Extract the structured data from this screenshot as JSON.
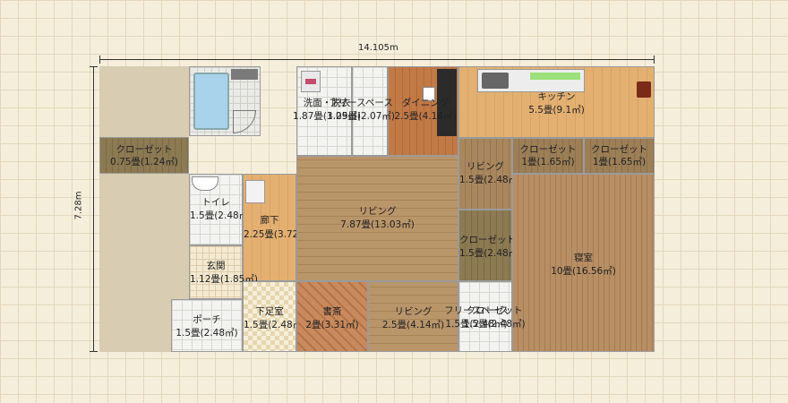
{
  "dimensions": {
    "width_label": "14.105m",
    "height_label": "7.28m"
  },
  "rooms": {
    "closet_left": {
      "name": "クローゼット",
      "size": "0.75畳(1.24㎡)"
    },
    "washroom": {
      "name": "洗面・脱衣",
      "size": "1.87畳(3.09㎡)"
    },
    "free_space": {
      "name": "フリースペース",
      "size": "1.25畳(2.07㎡)"
    },
    "dining": {
      "name": "ダイニング",
      "size": "2.5畳(4.14㎡)"
    },
    "kitchen": {
      "name": "キッチン",
      "size": "5.5畳(9.1㎡)"
    },
    "closet_a": {
      "name": "クローゼット",
      "size": "1畳(1.65㎡)"
    },
    "closet_b": {
      "name": "クローゼット",
      "size": "1畳(1.65㎡)"
    },
    "living_small": {
      "name": "リビング",
      "size": "1.5畳(2.48㎡)"
    },
    "toilet": {
      "name": "トイレ",
      "size": "1.5畳(2.48㎡)"
    },
    "hallway": {
      "name": "廊下",
      "size": "2.25畳(3.72㎡)"
    },
    "living_main": {
      "name": "リビング",
      "size": "7.87畳(13.03㎡)"
    },
    "closet_mid": {
      "name": "クローゼット",
      "size": "1.5畳(2.48㎡)"
    },
    "bedroom": {
      "name": "寝室",
      "size": "10畳(16.56㎡)"
    },
    "entrance": {
      "name": "玄関",
      "size": "1.12畳(1.85㎡)"
    },
    "porch": {
      "name": "ポーチ",
      "size": "1.5畳(2.48㎡)"
    },
    "shoe_room": {
      "name": "下足室",
      "size": "1.5畳(2.48㎡)"
    },
    "study": {
      "name": "書斎",
      "size": "2畳(3.31㎡)"
    },
    "living_bottom": {
      "name": "リビング",
      "size": "2.5畳(4.14㎡)"
    },
    "free_space2": {
      "name": "フリースペース",
      "size": "1.5畳(2.48㎡)"
    },
    "closet_small": {
      "name": "クローゼット",
      "size": "1.5畳(2.48㎡)"
    }
  }
}
